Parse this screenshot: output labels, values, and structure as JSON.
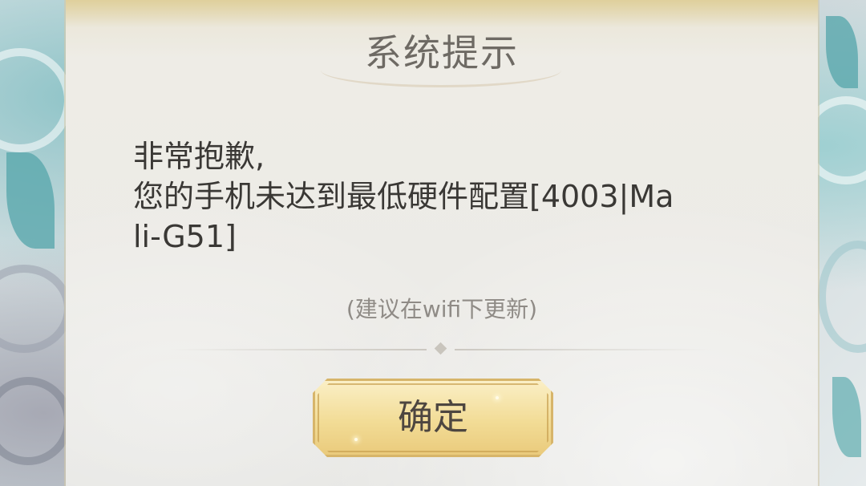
{
  "dialog": {
    "title": "系统提示",
    "message_lines": [
      "非常抱歉,",
      "您的手机未达到最低硬件配置[4003|Ma",
      "li-G51]"
    ],
    "hint": "(建议在wifi下更新)",
    "confirm_label": "确定"
  }
}
